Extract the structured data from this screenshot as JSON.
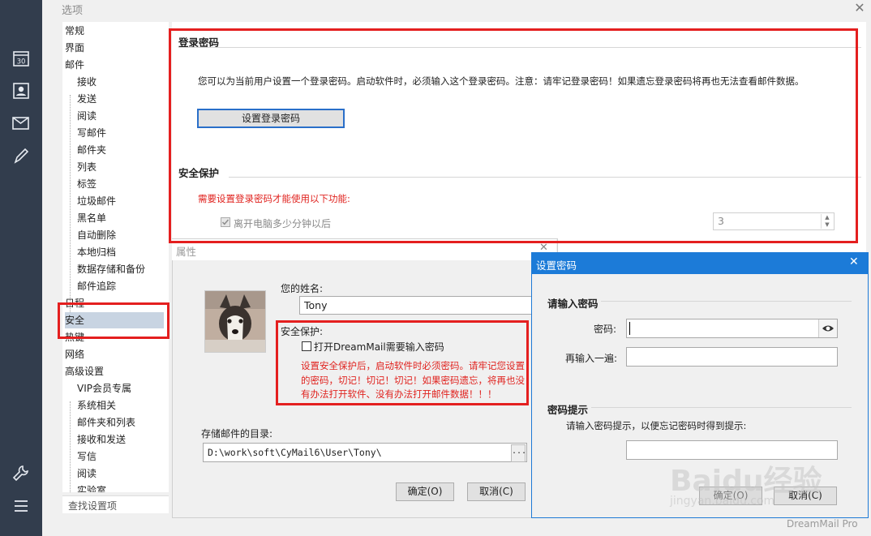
{
  "options_dialog": {
    "title": "选项",
    "tree": {
      "items": [
        {
          "label": "常规",
          "level": 0
        },
        {
          "label": "界面",
          "level": 0
        },
        {
          "label": "邮件",
          "level": 0
        },
        {
          "label": "接收",
          "level": 1
        },
        {
          "label": "发送",
          "level": 1
        },
        {
          "label": "阅读",
          "level": 1
        },
        {
          "label": "写邮件",
          "level": 1
        },
        {
          "label": "邮件夹",
          "level": 1
        },
        {
          "label": "列表",
          "level": 1
        },
        {
          "label": "标签",
          "level": 1
        },
        {
          "label": "垃圾邮件",
          "level": 1
        },
        {
          "label": "黑名单",
          "level": 1
        },
        {
          "label": "自动删除",
          "level": 1
        },
        {
          "label": "本地归档",
          "level": 1
        },
        {
          "label": "数据存储和备份",
          "level": 1
        },
        {
          "label": "邮件追踪",
          "level": 1
        },
        {
          "label": "日程",
          "level": 0
        },
        {
          "label": "安全",
          "level": 0,
          "selected": true
        },
        {
          "label": "热键",
          "level": 0
        },
        {
          "label": "网络",
          "level": 0
        },
        {
          "label": "高级设置",
          "level": 0
        },
        {
          "label": "VIP会员专属",
          "level": 1
        },
        {
          "label": "系统相关",
          "level": 1
        },
        {
          "label": "邮件夹和列表",
          "level": 1
        },
        {
          "label": "接收和发送",
          "level": 1
        },
        {
          "label": "写信",
          "level": 1
        },
        {
          "label": "阅读",
          "level": 1
        },
        {
          "label": "实验室",
          "level": 1
        }
      ],
      "search_placeholder": "查找设置项"
    },
    "login_password": {
      "heading": "登录密码",
      "description": "您可以为当前用户设置一个登录密码。启动软件时，必须输入这个登录密码。注意：请牢记登录密码！如果遗忘登录密码将再也无法查看邮件数据。",
      "set_button": "设置登录密码"
    },
    "security": {
      "heading": "安全保护",
      "warning": "需要设置登录密码才能使用以下功能:",
      "lock_option": "离开电脑多少分钟以后",
      "lock_checked": true,
      "minutes_value": "3"
    }
  },
  "properties_dialog": {
    "title": "属性",
    "name_label": "您的姓名:",
    "name_value": "Tony",
    "security_label": "安全保护:",
    "require_password_label": "打开DreamMail需要输入密码",
    "require_password_checked": false,
    "security_warning": [
      "设置安全保护后，启动软件时必须密码。请牢记您设置",
      "的密码，切记！切记！切记！如果密码遗忘，将再也没",
      "有办法打开软件、没有办法打开邮件数据！！！"
    ],
    "storage_label": "存储邮件的目录:",
    "storage_path": "D:\\work\\soft\\CyMail6\\User\\Tony\\",
    "browse_label": "...",
    "ok_label": "确定(O)",
    "cancel_label": "取消(C)"
  },
  "password_dialog": {
    "title": "设置密码",
    "enter_heading": "请输入密码",
    "password_label": "密码:",
    "password_value": "",
    "confirm_label": "再输入一遍:",
    "confirm_value": "",
    "hint_heading": "密码提示",
    "hint_instruction": "请输入密码提示，以便忘记密码时得到提示:",
    "hint_value": "",
    "ok_label": "确定(O)",
    "cancel_label": "取消(C)"
  },
  "watermark": {
    "brand": "Baidu经验",
    "url": "jingyan.baidu.com",
    "app": "DreamMail Pro"
  },
  "icons": {
    "rail": [
      "calendar-icon",
      "contacts-icon",
      "mail-icon",
      "compose-icon",
      "tools-icon",
      "menu-icon"
    ]
  },
  "colors": {
    "rail_bg": "#323d4d",
    "highlight_red": "#e41f1f",
    "dialog_blue": "#1c7bd8",
    "tree_selected": "#c8d4e2"
  }
}
